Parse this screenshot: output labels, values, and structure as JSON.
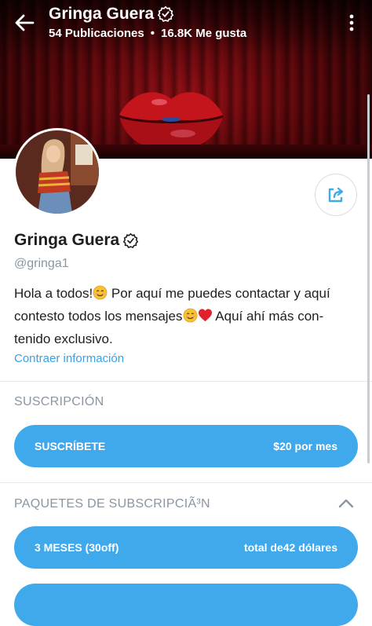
{
  "header": {
    "title": "Gringa Guera",
    "posts": "54 Publicaciones",
    "separator": "•",
    "likes": "16.8K Me gusta"
  },
  "profile": {
    "name": "Gringa Guera",
    "handle": "@gringa1",
    "bio_part1": "Hola a todos!",
    "bio_part2": " Por aquí me puedes contactar y aquí contesto todos los mensajes",
    "bio_part3": " Aquí ahí más con-tenido exclusivo.",
    "collapse_link": "Contraer información"
  },
  "subscription": {
    "label": "SUSCRIPCIÓN",
    "button_label": "SUSCRÍBETE",
    "price": "$20 por mes"
  },
  "bundles": {
    "label": "PAQUETES DE SUBSCRIPCIÃ³N",
    "items": [
      {
        "label": "3 MESES (30off)",
        "price": "total de42 dólares"
      },
      {
        "label": "",
        "price": ""
      }
    ]
  },
  "icons": {
    "back": "arrow-left-icon",
    "verified": "verified-badge-icon",
    "menu": "more-vertical-icon",
    "share": "share-icon",
    "collapse": "chevron-up-icon"
  },
  "colors": {
    "accent": "#3fa9ec",
    "link": "#3aa1e6",
    "muted": "#8a96a3"
  }
}
